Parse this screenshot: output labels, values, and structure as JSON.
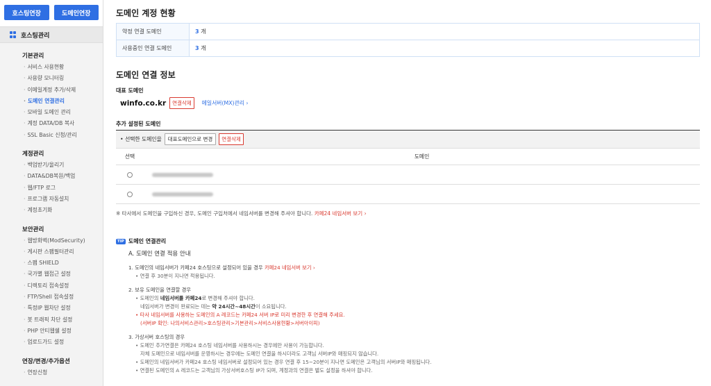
{
  "sidebar": {
    "buttons": [
      "호스팅연장",
      "도메인연장"
    ],
    "header": "호스팅관리",
    "sections": [
      {
        "title": "기본관리",
        "items": [
          "서비스 사용현황",
          "사용량 모니터링",
          "이메일계정 추가/삭제",
          "도메인 연결관리",
          "모바일 도메인 관리",
          "계정 DATA/DB 복사",
          "SSL Basic 신청/관리"
        ]
      },
      {
        "title": "계정관리",
        "items": [
          "백업받기/올리기",
          "DATA&DB복원/백업",
          "웹/FTP 로그",
          "프로그램 자동설치",
          "계정초기화"
        ]
      },
      {
        "title": "보안관리",
        "items": [
          "웹방화벽(ModSecurity)",
          "게시판 스팸필터관리",
          "스팸 SHIELD",
          "국가별 웹접근 설정",
          "디렉토리 접속설정",
          "FTP/Shell 접속설정",
          "특정IP 웹차단 설정",
          "봇 트래픽 차단 설정",
          "PHP 안티웹쉘 설정",
          "업로드가드 설정"
        ]
      },
      {
        "title": "연장/변경/추가옵션",
        "items": [
          "연장신청"
        ]
      }
    ],
    "active": "도메인 연결관리"
  },
  "status": {
    "title": "도메인 계정 현황",
    "rows": [
      {
        "label": "약정 연결 도메인",
        "count": "3",
        "unit": "개"
      },
      {
        "label": "사용중인 연결 도메인",
        "count": "3",
        "unit": "개"
      }
    ]
  },
  "connect": {
    "title": "도메인 연결 정보",
    "rep_label": "대표 도메인",
    "rep_domain": "winfo.co.kr",
    "delete_label": "연결삭제",
    "mx_link": "메일서버(MX)관리 ›",
    "added_label": "추가 설정된 도메인",
    "selected_text": "• 선택한 도메인을",
    "set_rep_btn": "대표도메인으로 변경",
    "delete_btn": "연결삭제",
    "col_select": "선택",
    "col_domain": "도메인",
    "note": "※ 타사에서 도메인을 구입하신 경우, 도메인 구입처에서 네임서버를 변경해 주셔야 합니다.",
    "note_link": "카페24 네임서버 보기 ›"
  },
  "guide": {
    "badge": "TIP",
    "title": "도메인 연결관리",
    "heading": "A. 도메인 연결 적용 안내",
    "q1": "1. 도메인의 네임서버가 카페24 호스팅으로 설정되어 있을 경우",
    "q1_link": "카페24 네임서버 보기 ›",
    "a1": "• 연결 후 30분이 지나면 적용됩니다.",
    "q2": "2. 보유 도메인을 연결할 경우",
    "a2_1_pre": "• 도메인의",
    "a2_1_strong": "네임서버를 카페24",
    "a2_1_post": "로 변경해 주셔야 합니다.",
    "a2_2_pre": "네임서버가 변경이 완료되는 데는",
    "a2_2_strong": "약 24시간~48시간",
    "a2_2_post": "이 소요됩니다.",
    "a2_3": "• 타사 네임서버를 사용하는 도메인의 A 레코드는 카페24 서버 IP로 미리 변경한 후 연결해 주세요.",
    "a2_4": "(서버IP 확인: 나의서비스관리>호스팅관리>기본관리>서비스사용현황>서버아이피)",
    "q3": "3. 가상서버 호스팅의 경우",
    "a3_1": "• 도메인 추가연결은 카페24 호스팅 네임서버를 사용하시는 경우에만 사용이 가능합니다.",
    "a3_2": "자체 도메인으로 네임서버를 운영하시는 경우에는 도메인 연결을 하시더라도 고객님 서버IP와 매핑되지 않습니다.",
    "a3_3": "• 도메인의 네임서버가 카페24 호스팅 네임서버로 설정되어 있는 경우 연결 후 15~20분이 지나면 도메인은 고객님의 서버IP와 매핑됩니다.",
    "a3_4": "• 연결된 도메인의 A 레코드는 고객님의 가상서버호스팅 IP가 되며, 계정과의 연결은 별도 설정을 하셔야 합니다."
  },
  "colors": {
    "accent": "#2f6fe3",
    "danger": "#d9392f"
  }
}
